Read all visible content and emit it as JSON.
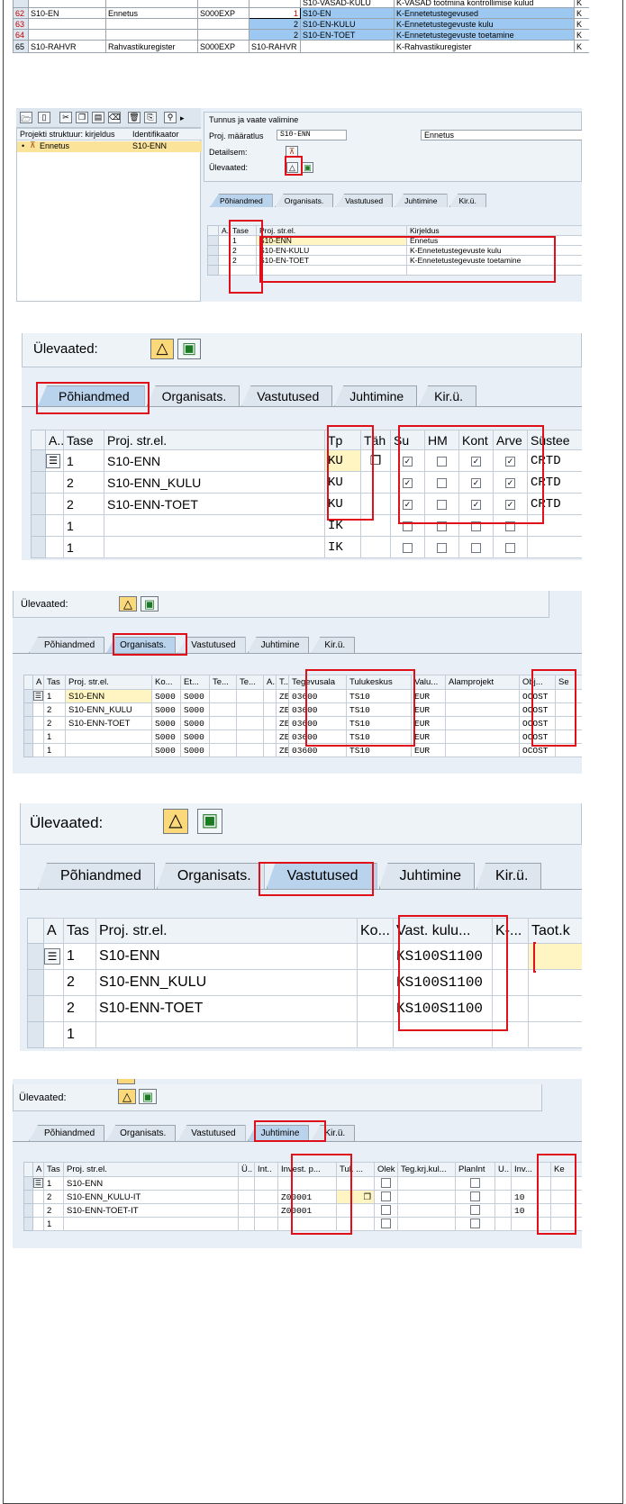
{
  "top_table": {
    "cut_row": {
      "rn": "61",
      "c5": "S10-VASAD-KULU",
      "c6": "K-VASAD tootmina kontrollimise kulud",
      "c7": "K"
    },
    "rows": [
      {
        "rn": "62",
        "id": "S10-EN",
        "name": "Ennetus",
        "code": "S000EXP",
        "level": "1",
        "elem": "S10-EN",
        "desc": "K-Ennetetustegevused",
        "end": "K"
      },
      {
        "rn": "63",
        "id": "",
        "name": "",
        "code": "",
        "level": "2",
        "elem": "S10-EN-KULU",
        "desc": "K-Ennetetustegevuste kulu",
        "end": "K"
      },
      {
        "rn": "64",
        "id": "",
        "name": "",
        "code": "",
        "level": "2",
        "elem": "S10-EN-TOET",
        "desc": "K-Ennetetustegevuste toetamine",
        "end": "K"
      },
      {
        "rn": "65",
        "id": "S10-RAHVR",
        "name": "Rahvastikuregister",
        "code": "S000EXP",
        "level": "S10-RAHVR",
        "elem": "",
        "desc": "K-Rahvastikuregister",
        "end": "K"
      }
    ]
  },
  "builder": {
    "tree_headers": [
      "Projekti struktuur: kirjeldus",
      "Identifikaator"
    ],
    "tree_item": {
      "label": "Ennetus",
      "id": "S10-ENN"
    },
    "section_title": "Tunnus ja vaate valimine",
    "proj_label": "Proj. määratlus",
    "proj_value": "S10-ENN",
    "proj_desc": "Ennetus",
    "detail_label": "Detailsem:",
    "overview_label": "Ülevaated:",
    "tabs": [
      "Põhiandmed",
      "Organisats.",
      "Vastutused",
      "Juhtimine",
      "Kir.ü."
    ],
    "headers": [
      "A..",
      "Tase",
      "Proj. str.el.",
      "Kirjeldus"
    ],
    "rows": [
      {
        "lvl": "1",
        "el": "S10-ENN",
        "desc": "Ennetus"
      },
      {
        "lvl": "2",
        "el": "S10-EN-KULU",
        "desc": "K-Ennetetustegevuste kulu"
      },
      {
        "lvl": "2",
        "el": "S10-EN-TOET",
        "desc": "K-Ennetetustegevuste toetamine"
      },
      {
        "lvl": "",
        "el": "",
        "desc": ""
      }
    ]
  },
  "s3": {
    "overview_label": "Ülevaated:",
    "tabs": [
      "Põhiandmed",
      "Organisats.",
      "Vastutused",
      "Juhtimine",
      "Kir.ü."
    ],
    "headers": [
      "A..",
      "Tase",
      "Proj. str.el.",
      "Tp",
      "Täh",
      "Su",
      "HM",
      "Kont",
      "Arve",
      "Süstee"
    ],
    "rows": [
      {
        "lvl": "1",
        "el": "S10-ENN",
        "tp": "KU",
        "su": true,
        "hm": false,
        "kont": true,
        "arve": true,
        "sys": "CRTD"
      },
      {
        "lvl": "2",
        "el": "S10-ENN_KULU",
        "tp": "KU",
        "su": true,
        "hm": false,
        "kont": true,
        "arve": true,
        "sys": "CRTD"
      },
      {
        "lvl": "2",
        "el": "S10-ENN-TOET",
        "tp": "KU",
        "su": true,
        "hm": false,
        "kont": true,
        "arve": true,
        "sys": "CRTD"
      },
      {
        "lvl": "1",
        "el": "",
        "tp": "IK",
        "su": false,
        "hm": false,
        "kont": false,
        "arve": false,
        "sys": ""
      },
      {
        "lvl": "1",
        "el": "",
        "tp": "IK",
        "su": false,
        "hm": false,
        "kont": false,
        "arve": false,
        "sys": ""
      }
    ]
  },
  "s4": {
    "overview_label": "Ülevaated:",
    "tabs": [
      "Põhiandmed",
      "Organisats.",
      "Vastutused",
      "Juhtimine",
      "Kir.ü."
    ],
    "headers": [
      "A",
      "Tas",
      "Proj. str.el.",
      "Ko...",
      "Et...",
      "Te...",
      "Te...",
      "A..",
      "T..",
      "Tegevusala",
      "Tulukeskus",
      "Valu...",
      "Alamprojekt",
      "Obj...",
      "Se"
    ],
    "rows": [
      {
        "lvl": "1",
        "el": "S10-ENN",
        "ko": "S000",
        "et": "S000",
        "t": "ZE",
        "teg": "03600",
        "tulu": "TS10",
        "val": "EUR",
        "obj": "OCOST"
      },
      {
        "lvl": "2",
        "el": "S10-ENN_KULU",
        "ko": "S000",
        "et": "S000",
        "t": "ZE",
        "teg": "03600",
        "tulu": "TS10",
        "val": "EUR",
        "obj": "OCOST"
      },
      {
        "lvl": "2",
        "el": "S10-ENN-TOET",
        "ko": "S000",
        "et": "S000",
        "t": "ZE",
        "teg": "03600",
        "tulu": "TS10",
        "val": "EUR",
        "obj": "OCOST"
      },
      {
        "lvl": "1",
        "el": "",
        "ko": "S000",
        "et": "S000",
        "t": "ZE",
        "teg": "03600",
        "tulu": "TS10",
        "val": "EUR",
        "obj": "OCOST"
      },
      {
        "lvl": "1",
        "el": "",
        "ko": "S000",
        "et": "S000",
        "t": "ZE",
        "teg": "03600",
        "tulu": "TS10",
        "val": "EUR",
        "obj": "OCOST"
      }
    ]
  },
  "s5": {
    "overview_label": "Ülevaated:",
    "tabs": [
      "Põhiandmed",
      "Organisats.",
      "Vastutused",
      "Juhtimine",
      "Kir.ü."
    ],
    "headers": [
      "A",
      "Tas",
      "Proj. str.el.",
      "Ko...",
      "Vast. kulu...",
      "K-...",
      "Taot.k"
    ],
    "rows": [
      {
        "lvl": "1",
        "el": "S10-ENN",
        "vk": "KS100S1100"
      },
      {
        "lvl": "2",
        "el": "S10-ENN_KULU",
        "vk": "KS100S1100"
      },
      {
        "lvl": "2",
        "el": "S10-ENN-TOET",
        "vk": "KS100S1100"
      },
      {
        "lvl": "1",
        "el": "",
        "vk": ""
      }
    ]
  },
  "s6": {
    "overview_label": "Ülevaated:",
    "tabs": [
      "Põhiandmed",
      "Organisats.",
      "Vastutused",
      "Juhtimine",
      "Kir.ü."
    ],
    "headers": [
      "A",
      "Tas",
      "Proj. str.el.",
      "Ü..",
      "Int..",
      "Invest. p...",
      "Tul. ...",
      "Olek",
      "Teg.krj.kul...",
      "PlanInt",
      "U..",
      "Inv...",
      "Ke"
    ],
    "rows": [
      {
        "lvl": "1",
        "el": "S10-ENN",
        "ip": "",
        "inv": ""
      },
      {
        "lvl": "2",
        "el": "S10-ENN_KULU-IT",
        "ip": "Z00001",
        "inv": "10"
      },
      {
        "lvl": "2",
        "el": "S10-ENN-TOET-IT",
        "ip": "Z00001",
        "inv": "10"
      },
      {
        "lvl": "1",
        "el": "",
        "ip": "",
        "inv": ""
      }
    ]
  }
}
